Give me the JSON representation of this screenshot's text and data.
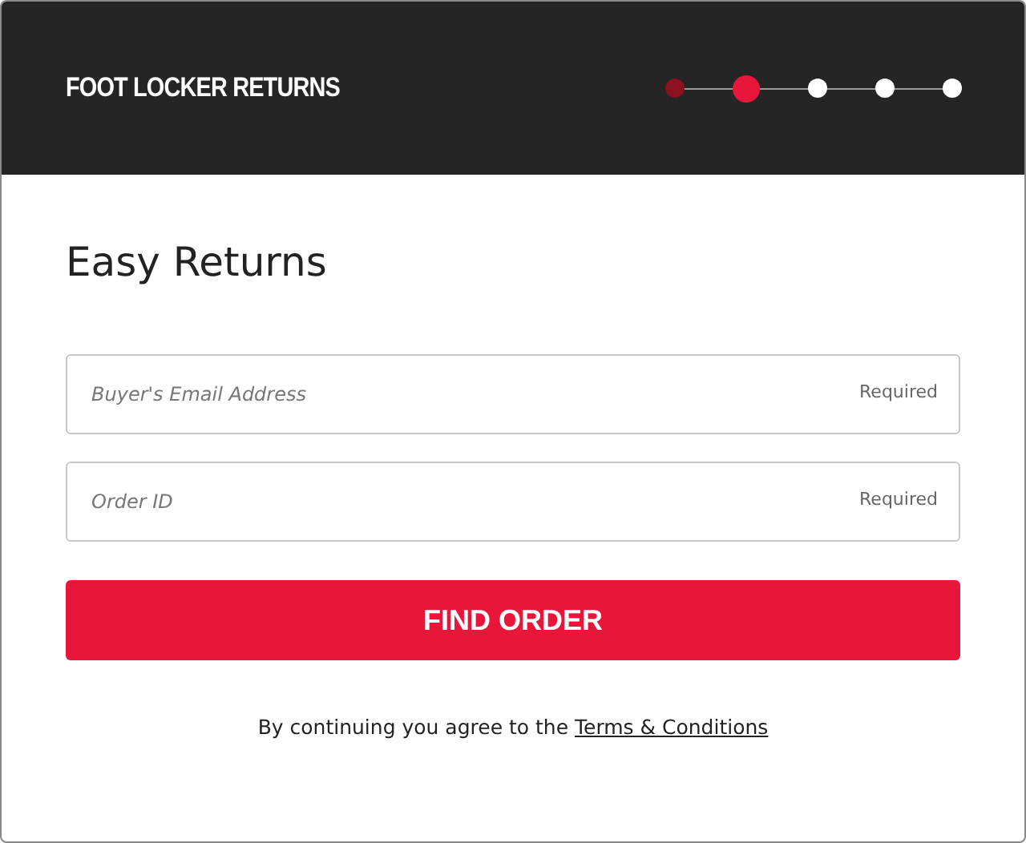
{
  "header": {
    "title": "FOOT LOCKER RETURNS",
    "steps": [
      {
        "completed": true,
        "selected": false
      },
      {
        "completed": false,
        "selected": true
      },
      {
        "completed": false,
        "selected": false
      },
      {
        "completed": false,
        "selected": false
      },
      {
        "completed": false,
        "selected": false
      }
    ]
  },
  "heading": "Easy Returns",
  "fields": [
    {
      "placeholder": "Buyer's Email Address",
      "hint": "Required"
    },
    {
      "placeholder": "Order ID",
      "hint": "Required"
    }
  ],
  "button": "FIND ORDER",
  "terms": {
    "text": "By continuing you agree to the",
    "link": "Terms & Conditions"
  }
}
